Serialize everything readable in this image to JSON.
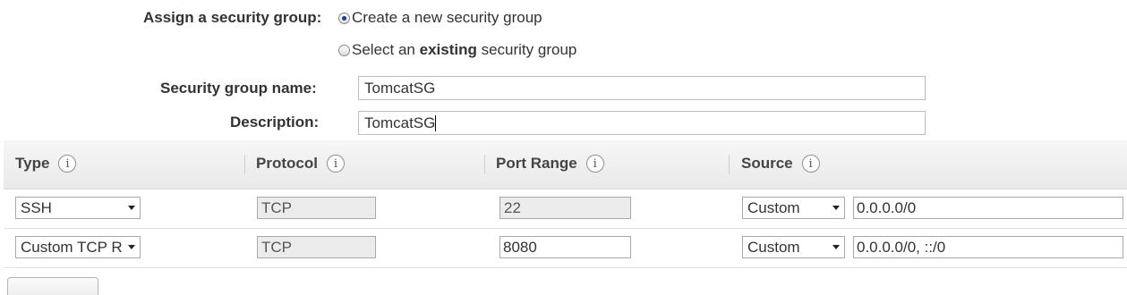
{
  "security_group": {
    "assign_label": "Assign a security group:",
    "option_create_label": "Create a new security group",
    "option_existing_prefix": "Select an ",
    "option_existing_bold": "existing",
    "option_existing_suffix": " security group",
    "name_label": "Security group name:",
    "name_value": "TomcatSG",
    "description_label": "Description:",
    "description_value": "TomcatSG"
  },
  "rules_table": {
    "columns": [
      {
        "label": "Type"
      },
      {
        "label": "Protocol"
      },
      {
        "label": "Port Range"
      },
      {
        "label": "Source"
      }
    ],
    "info_glyph": "i",
    "rows": [
      {
        "type": "SSH",
        "protocol": "TCP",
        "port_range": "22",
        "source_select": "Custom",
        "source_value": "0.0.0.0/0"
      },
      {
        "type": "Custom TCP R",
        "protocol": "TCP",
        "port_range": "8080",
        "source_select": "Custom",
        "source_value": "0.0.0.0/0, ::/0"
      }
    ]
  },
  "icons": {
    "info": "info-icon",
    "dropdown": "chevron-down-icon",
    "radio": "radio-button"
  }
}
